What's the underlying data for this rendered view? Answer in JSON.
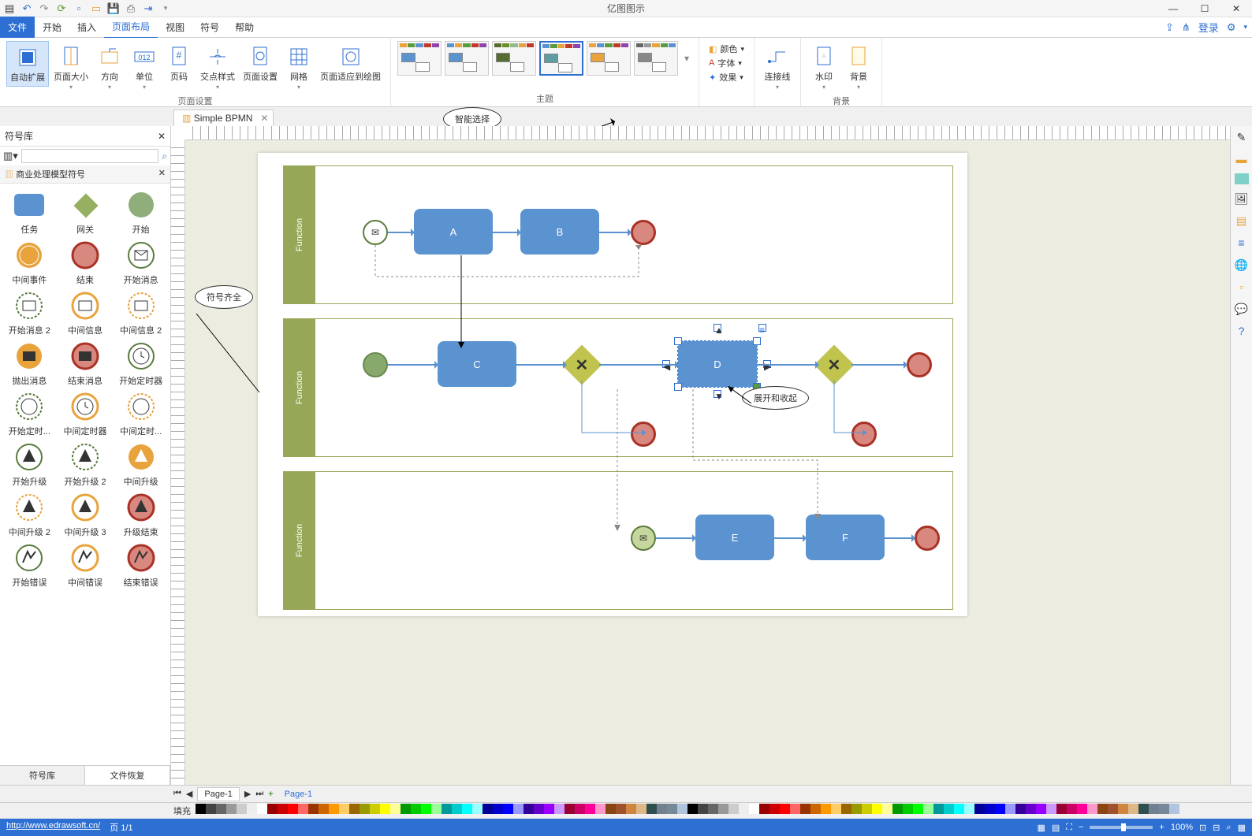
{
  "app": {
    "title": "亿图图示"
  },
  "qat": [
    "app",
    "undo",
    "redo",
    "refresh",
    "new",
    "open",
    "save",
    "print",
    "export",
    "more"
  ],
  "window_controls": {
    "min": "—",
    "max": "☐",
    "close": "✕"
  },
  "menu": {
    "file": "文件",
    "items": [
      "开始",
      "插入",
      "页面布局",
      "视图",
      "符号",
      "帮助"
    ],
    "active": "页面布局",
    "right": {
      "share": "⇪",
      "send": "⋔",
      "login": "登录",
      "settings": "⚙",
      "help": "?"
    }
  },
  "ribbon": {
    "page_group": {
      "label": "页面设置",
      "buttons": [
        {
          "id": "auto-expand",
          "label": "自动扩展",
          "active": true
        },
        {
          "id": "page-size",
          "label": "页面大小",
          "drop": true
        },
        {
          "id": "orientation",
          "label": "方向",
          "drop": true
        },
        {
          "id": "units",
          "label": "单位",
          "drop": true
        },
        {
          "id": "page-num",
          "label": "页码"
        },
        {
          "id": "cross-style",
          "label": "交点样式",
          "drop": true
        },
        {
          "id": "page-setup",
          "label": "页面设置"
        },
        {
          "id": "grid",
          "label": "网格",
          "drop": true
        },
        {
          "id": "fit-canvas",
          "label": "页面适应到绘图"
        }
      ]
    },
    "theme_group": {
      "label": "主题",
      "note": "智能选择"
    },
    "text_group": {
      "color": "颜色",
      "font": "字体",
      "effect": "效果",
      "connector": "连接线"
    },
    "bg_group": {
      "label": "背景",
      "watermark": "水印",
      "bg": "背景"
    }
  },
  "document_tab": {
    "name": "Simple BPMN"
  },
  "sidebar": {
    "title": "符号库",
    "category": "商业处理模型符号",
    "search_placeholder": "",
    "tabs": {
      "shapes": "符号库",
      "recover": "文件恢复"
    },
    "note": "符号齐全",
    "shapes": [
      [
        "任务",
        "网关",
        "开始"
      ],
      [
        "中间事件",
        "结束",
        "开始消息"
      ],
      [
        "开始消息 2",
        "中间信息",
        "中间信息 2"
      ],
      [
        "抛出消息",
        "结束消息",
        "开始定时器"
      ],
      [
        "开始定时...",
        "中间定时器",
        "中间定时..."
      ],
      [
        "开始升级",
        "开始升级 2",
        "中间升级"
      ],
      [
        "中间升级 2",
        "中间升级 3",
        "升级结束"
      ],
      [
        "开始错误",
        "中间错误",
        "结束错误"
      ]
    ]
  },
  "canvas": {
    "lanes": [
      {
        "label": "Function",
        "tasks": [
          {
            "id": "A",
            "label": "A"
          },
          {
            "id": "B",
            "label": "B"
          }
        ]
      },
      {
        "label": "Function",
        "tasks": [
          {
            "id": "C",
            "label": "C"
          },
          {
            "id": "D",
            "label": "D"
          }
        ]
      },
      {
        "label": "Function",
        "tasks": [
          {
            "id": "E",
            "label": "E"
          },
          {
            "id": "F",
            "label": "F"
          }
        ]
      }
    ],
    "note_expand": "展开和收起"
  },
  "page_tabs": {
    "current": "Page-1",
    "link": "Page-1",
    "add": "+"
  },
  "status": {
    "url": "http://www.edrawsoft.cn/",
    "page": "页 1/1",
    "fill": "填充",
    "zoom": "100%"
  }
}
